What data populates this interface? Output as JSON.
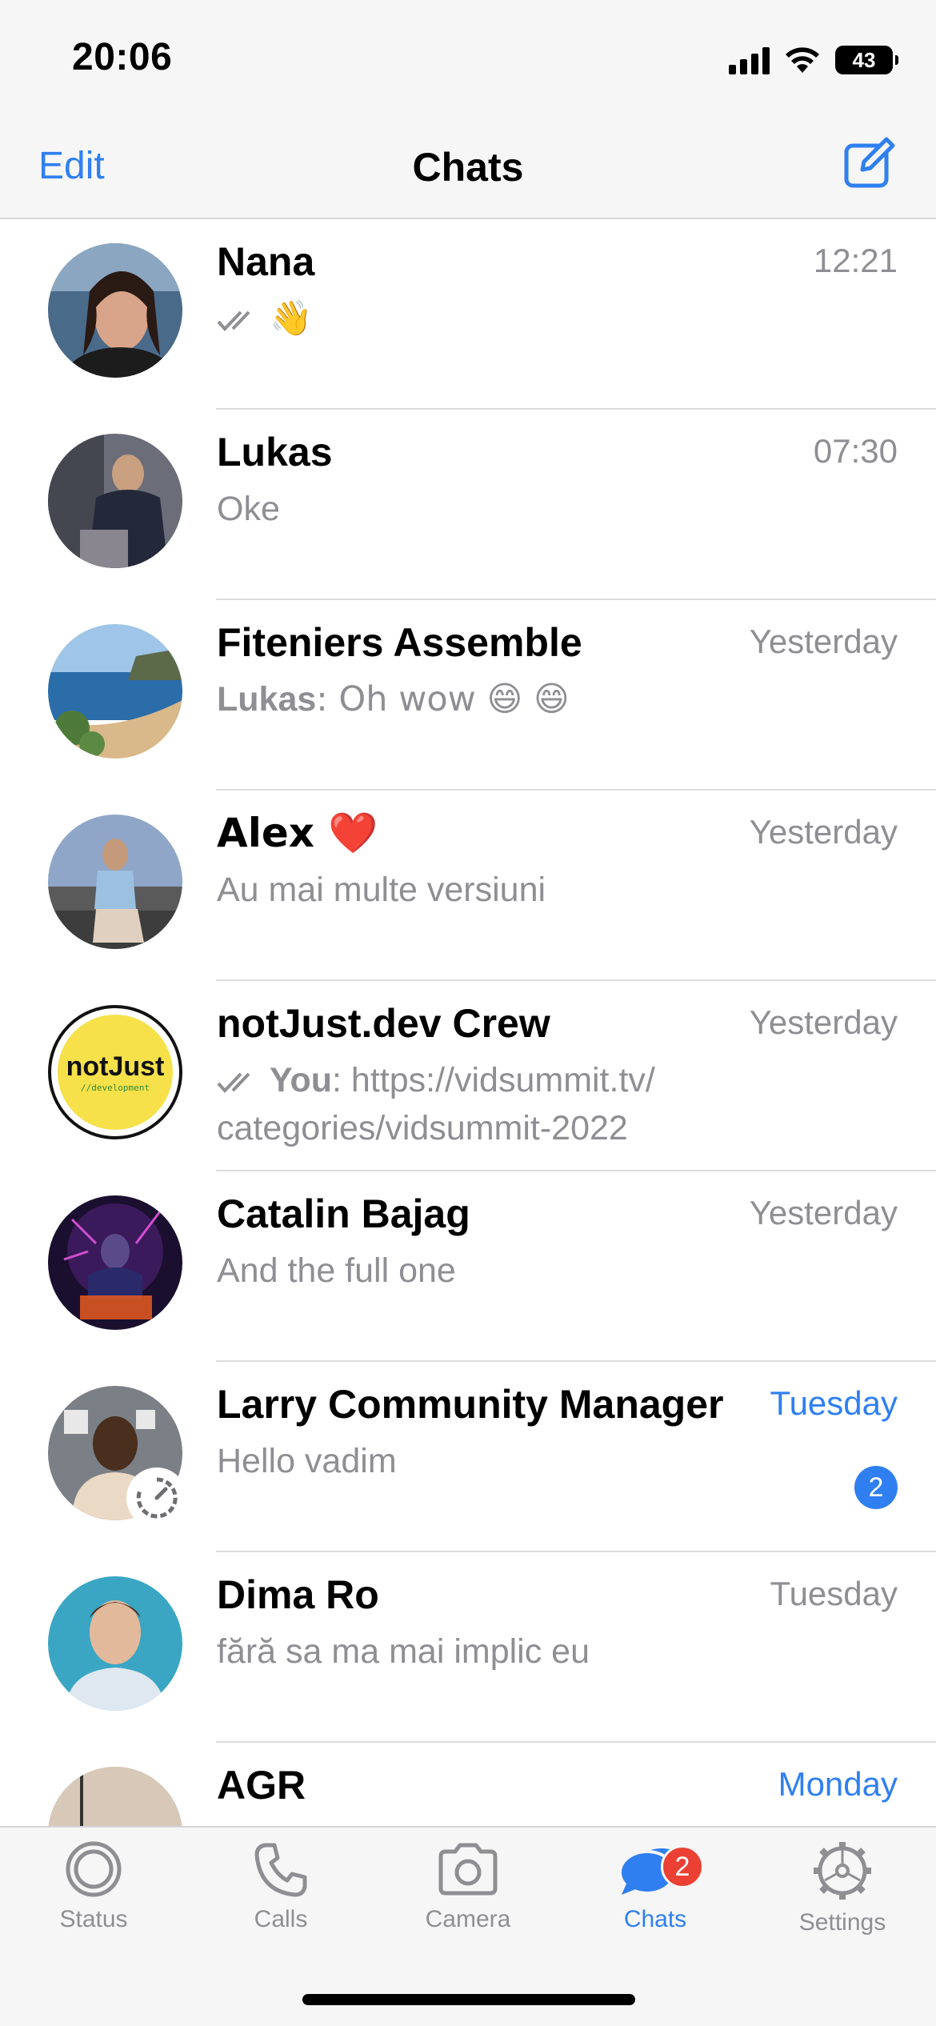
{
  "status_bar": {
    "time": "20:06",
    "battery": "43"
  },
  "nav": {
    "edit_label": "Edit",
    "title": "Chats",
    "compose_icon": "compose-icon"
  },
  "chats": [
    {
      "name": "Nana",
      "time": "12:21",
      "preview": "👋",
      "read_ticks": true
    },
    {
      "name": "Lukas",
      "time": "07:30",
      "preview": "Oke"
    },
    {
      "name": "Fiteniers Assemble",
      "time": "Yesterday",
      "sender": "Lukas",
      "preview": ": Oh wow 😄 😄"
    },
    {
      "name": "Alex ❤️",
      "time": "Yesterday",
      "preview": "Au mai multe versiuni"
    },
    {
      "name": "notJust.dev Crew",
      "time": "Yesterday",
      "read_ticks": true,
      "sender": "You",
      "preview": ": https://vidsummit.tv/ categories/vidsummit-2022",
      "avatar_text": "notJust",
      "avatar_subtext": "//development"
    },
    {
      "name": "Catalin Bajag",
      "time": "Yesterday",
      "preview": "And the full one"
    },
    {
      "name": "Larry Community Manager",
      "time": "Tuesday",
      "preview": "Hello vadim",
      "unread": "2"
    },
    {
      "name": "Dima Ro",
      "time": "Tuesday",
      "preview": "fără sa ma mai implic eu"
    },
    {
      "name": "AGR",
      "time": "Monday",
      "preview": ""
    }
  ],
  "tabs": [
    {
      "label": "Status",
      "icon": "status-icon"
    },
    {
      "label": "Calls",
      "icon": "phone-icon"
    },
    {
      "label": "Camera",
      "icon": "camera-icon"
    },
    {
      "label": "Chats",
      "icon": "chat-bubbles-icon",
      "badge": "2",
      "active": true
    },
    {
      "label": "Settings",
      "icon": "gear-icon"
    }
  ],
  "colors": {
    "accent": "#2f7ff0",
    "badge_red": "#eb4034",
    "secondary_text": "#8e8e93"
  }
}
